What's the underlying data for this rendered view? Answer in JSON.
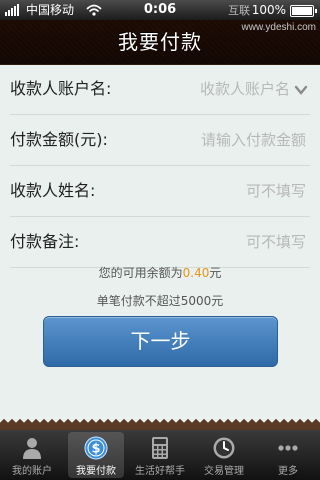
{
  "status_bar": {
    "carrier": "中国移动",
    "time": "0:06",
    "battery": "100%",
    "watermark": "互联"
  },
  "nav": {
    "title": "我要付款",
    "watermark": "www.ydeshi.com"
  },
  "form": {
    "rows": [
      {
        "label": "收款人账户名:",
        "value": "收款人账户名"
      },
      {
        "label": "付款金额(元):",
        "value": "请输入付款金额"
      },
      {
        "label": "收款人姓名:",
        "value": "可不填写"
      },
      {
        "label": "付款备注:",
        "value": "可不填写"
      }
    ]
  },
  "info": {
    "balance_prefix": "您的可用余额为",
    "balance_amount": "0.40",
    "balance_unit": "元",
    "limit_text": "单笔付款不超过5000元"
  },
  "buttons": {
    "next": "下一步"
  },
  "tabs": [
    {
      "label": "我的账户",
      "icon": "person-icon",
      "active": false
    },
    {
      "label": "我要付款",
      "icon": "dollar-coin-icon",
      "active": true
    },
    {
      "label": "生活好帮手",
      "icon": "calculator-icon",
      "active": false
    },
    {
      "label": "交易管理",
      "icon": "clock-icon",
      "active": false
    },
    {
      "label": "更多",
      "icon": "more-dots-icon",
      "active": false
    }
  ],
  "colors": {
    "nav_brown": "#4a2e1d",
    "button_blue": "#2f6aa8",
    "amount_orange": "#e8941a",
    "background": "#e9f0ee"
  }
}
